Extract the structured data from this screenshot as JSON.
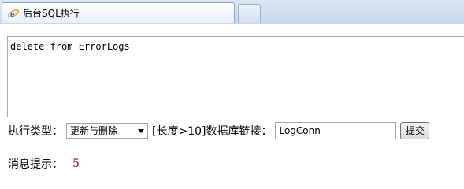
{
  "tab": {
    "title": "后台SQL执行",
    "icon": "ie-icon"
  },
  "sql": {
    "value": "delete from ErrorLogs"
  },
  "form": {
    "type_label": "执行类型：",
    "type_selected": "更新与删除",
    "conn_label": "[长度>10]数据库链接：",
    "conn_value": "LogConn",
    "submit_label": "提交"
  },
  "message": {
    "label": "消息提示：",
    "value": "5"
  },
  "colors": {
    "message_value": "#c00000"
  }
}
